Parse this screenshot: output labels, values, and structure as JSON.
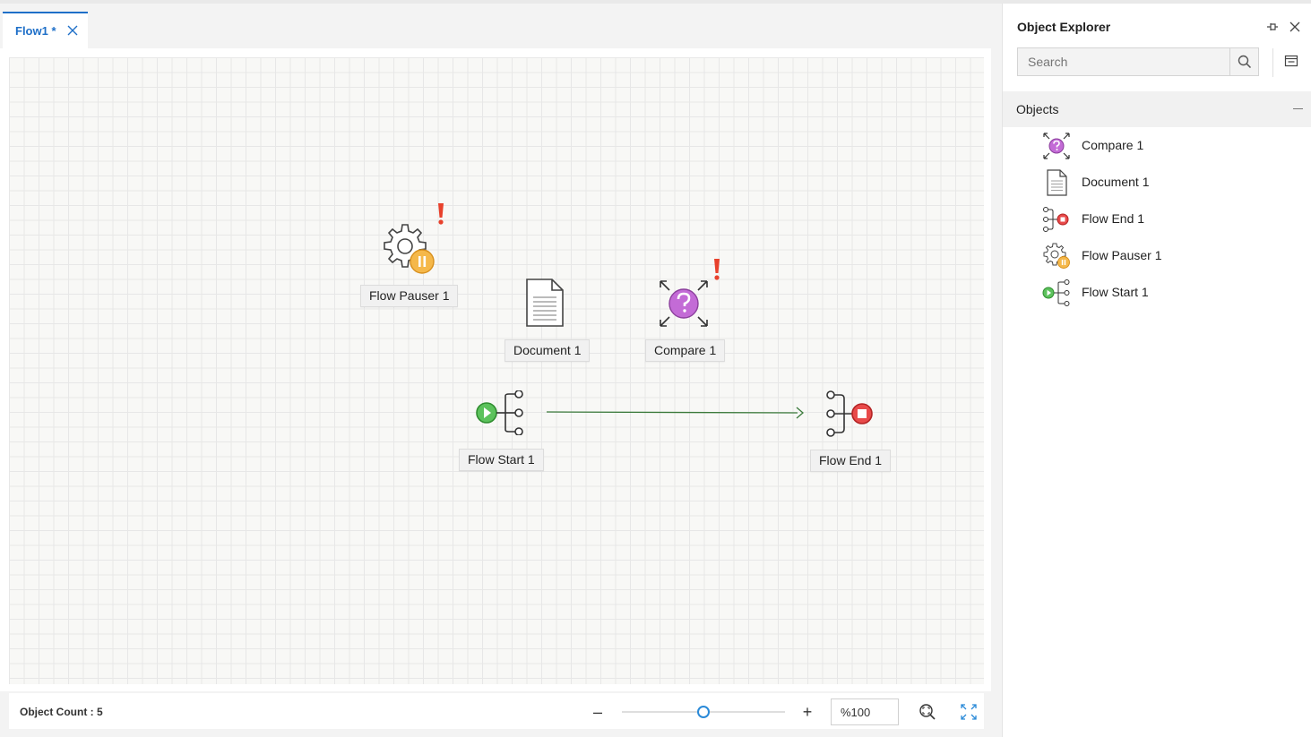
{
  "tabs": [
    {
      "label": "Flow1 *"
    }
  ],
  "canvas": {
    "nodes": {
      "flow_pauser": {
        "label": "Flow Pauser 1",
        "icon": "gear-pause-icon",
        "warning": "!"
      },
      "document": {
        "label": "Document 1",
        "icon": "document-icon"
      },
      "compare": {
        "label": "Compare 1",
        "icon": "compare-question-icon",
        "warning": "!"
      },
      "flow_start": {
        "label": "Flow Start 1",
        "icon": "flow-start-icon"
      },
      "flow_end": {
        "label": "Flow End 1",
        "icon": "flow-end-icon"
      }
    },
    "connector_color": "#3b7a3b"
  },
  "statusbar": {
    "object_count": "Object Count : 5",
    "zoom_out": "–",
    "zoom_in": "+",
    "zoom_level": "%100",
    "zoom_slider_fraction": 0.5
  },
  "explorer": {
    "title": "Object Explorer",
    "search_placeholder": "Search",
    "section_title": "Objects",
    "items": [
      {
        "label": "Compare 1",
        "icon": "compare-question-icon"
      },
      {
        "label": "Document 1",
        "icon": "document-icon"
      },
      {
        "label": "Flow End 1",
        "icon": "flow-end-icon"
      },
      {
        "label": "Flow Pauser 1",
        "icon": "gear-pause-icon"
      },
      {
        "label": "Flow Start 1",
        "icon": "flow-start-icon"
      }
    ]
  },
  "colors": {
    "accent": "#1e6fc8",
    "warning": "#e8412c",
    "start_green": "#5cc25c",
    "end_red": "#e84a4a",
    "pause_orange": "#f5b84a",
    "compare_purple": "#c36bd6"
  }
}
